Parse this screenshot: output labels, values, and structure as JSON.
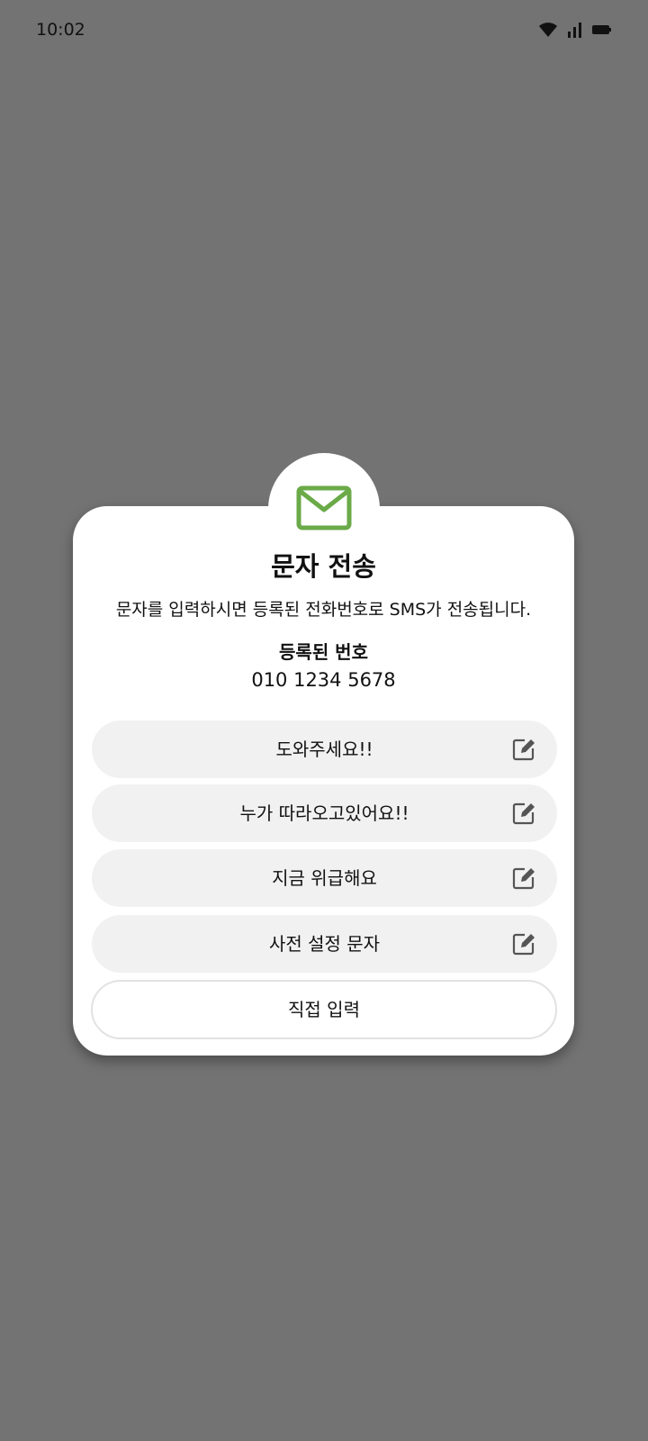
{
  "status_bar": {
    "time": "10:02",
    "icons": [
      "wifi-icon",
      "signal-icon",
      "battery-icon"
    ]
  },
  "dialog": {
    "icon": "mail-icon",
    "accent_color": "#6aaa48",
    "title": "문자 전송",
    "description": "문자를 입력하시면 등록된 전화번호로 SMS가 전송됩니다.",
    "registered_label": "등록된 번호",
    "registered_number": "010 1234 5678",
    "messages": [
      {
        "label": "도와주세요!!",
        "icon": "edit-icon"
      },
      {
        "label": "누가 따라오고있어요!!",
        "icon": "edit-icon"
      },
      {
        "label": "지금 위급해요",
        "icon": "edit-icon"
      },
      {
        "label": "사전 설정 문자",
        "icon": "edit-icon"
      }
    ],
    "direct_input_label": "직접 입력"
  }
}
